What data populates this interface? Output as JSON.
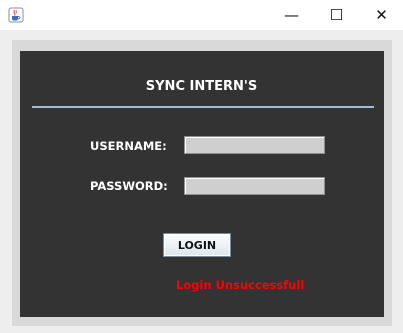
{
  "window": {
    "icon": "java-cup-icon",
    "controls": {
      "minimize_glyph": "—",
      "maximize_glyph": "☐",
      "close_glyph": "✕"
    }
  },
  "form": {
    "title": "SYNC INTERN'S",
    "username_label": "USERNAME:",
    "username_value": "",
    "password_label": "PASSWORD:",
    "password_value": "",
    "login_label": "LOGIN",
    "status_text": "Login Unsuccessfull"
  },
  "colors": {
    "panel_background": "#333333",
    "divider": "#a9b8d6",
    "status_error": "#ff0000"
  }
}
